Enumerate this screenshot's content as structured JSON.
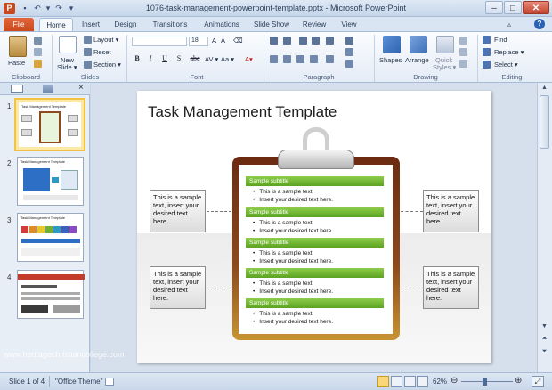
{
  "window": {
    "title": "1076-task-management-powerpoint-template.pptx - Microsoft PowerPoint",
    "app_icon": "P",
    "controls": [
      "–",
      "□",
      "✕"
    ]
  },
  "tabs": [
    "File",
    "Home",
    "Insert",
    "Design",
    "Transitions",
    "Animations",
    "Slide Show",
    "Review",
    "View"
  ],
  "ribbon": {
    "clipboard": {
      "paste": "Paste",
      "label": "Clipboard"
    },
    "slides": {
      "new_slide": "New",
      "new_slide2": "Slide ▾",
      "layout": "Layout ▾",
      "reset": "Reset",
      "section": "Section ▾",
      "label": "Slides"
    },
    "font": {
      "size_value": "18",
      "bold": "B",
      "italic": "I",
      "underline": "U",
      "strike": "S",
      "shadow": "abc",
      "spacing": "AV ▾",
      "case": "Aa ▾",
      "label": "Font"
    },
    "paragraph": {
      "label": "Paragraph"
    },
    "drawing": {
      "shapes": "Shapes",
      "arrange": "Arrange",
      "quick_styles": "Quick",
      "quick_styles2": "Styles ▾",
      "label": "Drawing"
    },
    "editing": {
      "find": "Find",
      "replace": "Replace ▾",
      "select": "Select ▾",
      "label": "Editing"
    }
  },
  "slide": {
    "title": "Task Management Template",
    "side_box_text": "This is a sample text, insert your desired text here.",
    "sections": [
      {
        "subtitle": "Sample subtitle",
        "bullets": [
          "This is a sample text.",
          "Insert your desired text here."
        ]
      },
      {
        "subtitle": "Sample subtitle",
        "bullets": [
          "This is a sample text.",
          "Insert your desired text here."
        ]
      },
      {
        "subtitle": "Sample subtitle",
        "bullets": [
          "This is a sample text.",
          "Insert your desired text here."
        ]
      },
      {
        "subtitle": "Sample subtitle",
        "bullets": [
          "This is a sample text.",
          "Insert your desired text here."
        ]
      },
      {
        "subtitle": "Sample subtitle",
        "bullets": [
          "This is a sample text.",
          "Insert your desired text here."
        ]
      }
    ]
  },
  "thumbnails": {
    "numbers": [
      "1",
      "2",
      "3",
      "4"
    ],
    "title_small": "Task Management Template"
  },
  "watermark": "www.heritagechristiancollege.com",
  "status": {
    "slide_info": "Slide 1 of 4",
    "theme": "\"Office Theme\"",
    "zoom": "62%"
  },
  "colors": {
    "file_tab": "#d3572a",
    "subtitle_bar": "#6cb22c",
    "clipboard_board": "#8e4a1a",
    "selected_thumb": "#f2c443"
  }
}
